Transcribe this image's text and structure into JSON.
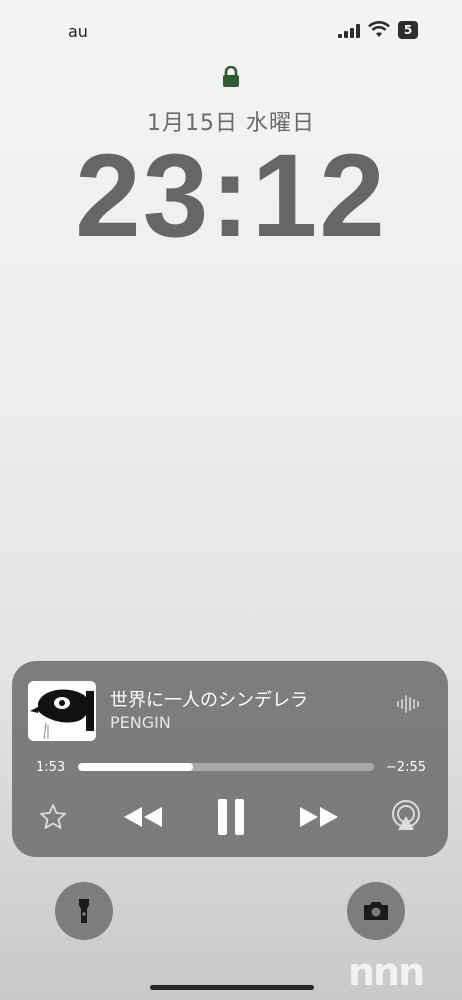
{
  "status_bar": {
    "carrier": "au",
    "battery_level": "5"
  },
  "lock_screen": {
    "date": "1月15日 水曜日",
    "time": "23:12"
  },
  "now_playing": {
    "title": "世界に一人のシンデレラ",
    "artist": "PENGIN",
    "elapsed": "1:53",
    "remaining": "−2:55",
    "progress_fraction": 0.39,
    "controls": [
      "star-icon",
      "rewind-icon",
      "pause-icon",
      "fast-forward-icon",
      "airplay-icon"
    ]
  },
  "quick_actions": [
    "flashlight-icon",
    "camera-icon"
  ],
  "watermark": "nnn",
  "colors": {
    "player_bg": "#6e6e6e",
    "lock_green": "#2e5c33",
    "accent_white": "#ffffff"
  }
}
